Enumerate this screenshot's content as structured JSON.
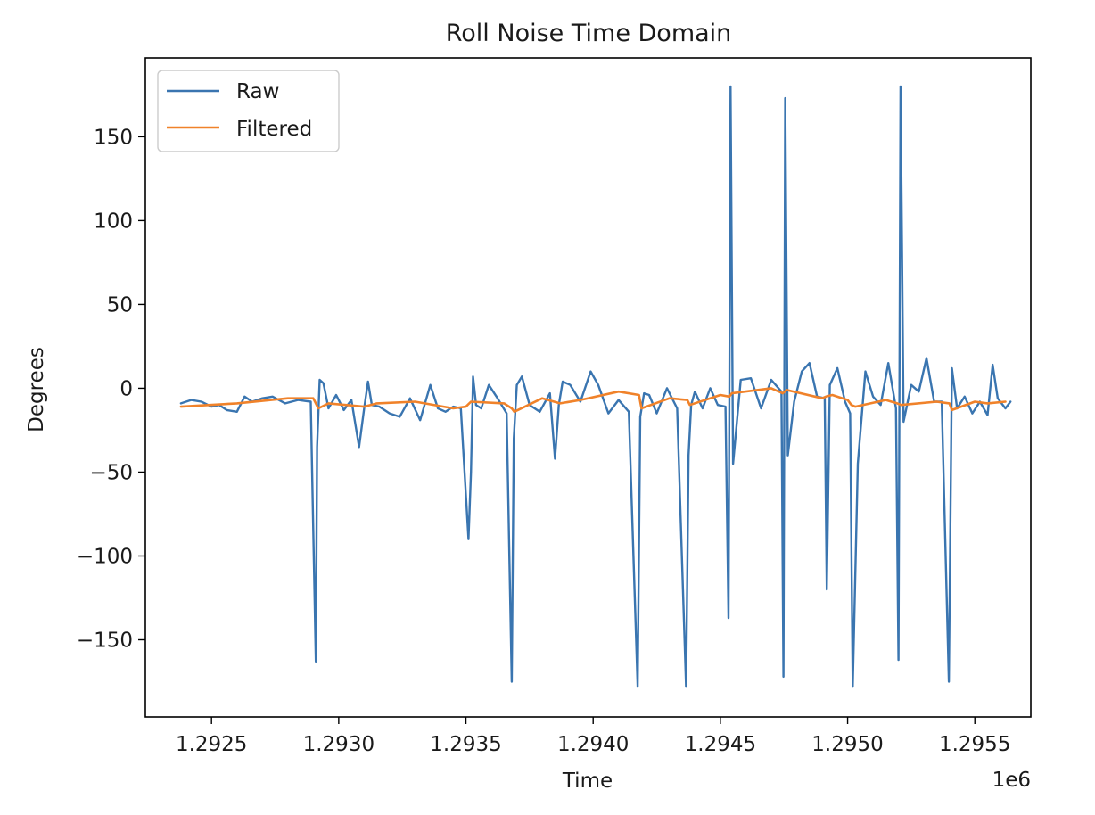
{
  "chart_data": {
    "type": "line",
    "title": "Roll Noise Time Domain",
    "xlabel": "Time",
    "ylabel": "Degrees",
    "x_offset_label": "1e6",
    "xlim": [
      1292240,
      1295720
    ],
    "ylim": [
      -196,
      197
    ],
    "xticks": [
      1292500,
      1293000,
      1293500,
      1294000,
      1294500,
      1295000,
      1295500
    ],
    "xtick_labels": [
      "1.2925",
      "1.2930",
      "1.2935",
      "1.2940",
      "1.2945",
      "1.2950",
      "1.2955"
    ],
    "yticks": [
      -150,
      -100,
      -50,
      0,
      50,
      100,
      150
    ],
    "ytick_labels": [
      "−150",
      "−100",
      "−50",
      "0",
      "50",
      "100",
      "150"
    ],
    "grid": false,
    "legend": {
      "position": "top-left"
    },
    "series": [
      {
        "name": "Raw",
        "color": "#3a75b0",
        "x": [
          1292380,
          1292420,
          1292460,
          1292500,
          1292530,
          1292560,
          1292600,
          1292630,
          1292660,
          1292700,
          1292740,
          1292790,
          1292840,
          1292890,
          1292910,
          1292915,
          1292925,
          1292940,
          1292960,
          1292990,
          1293020,
          1293050,
          1293080,
          1293100,
          1293115,
          1293130,
          1293160,
          1293200,
          1293240,
          1293280,
          1293320,
          1293360,
          1293390,
          1293420,
          1293450,
          1293480,
          1293510,
          1293520,
          1293528,
          1293540,
          1293560,
          1293590,
          1293620,
          1293660,
          1293680,
          1293688,
          1293700,
          1293720,
          1293750,
          1293790,
          1293830,
          1293850,
          1293865,
          1293880,
          1293910,
          1293950,
          1293990,
          1294020,
          1294060,
          1294100,
          1294140,
          1294175,
          1294185,
          1294200,
          1294220,
          1294250,
          1294290,
          1294330,
          1294365,
          1294375,
          1294385,
          1294400,
          1294430,
          1294460,
          1294490,
          1294520,
          1294532,
          1294540,
          1294550,
          1294580,
          1294620,
          1294660,
          1294700,
          1294740,
          1294748,
          1294755,
          1294765,
          1294790,
          1294820,
          1294850,
          1294880,
          1294910,
          1294918,
          1294930,
          1294960,
          1294990,
          1295010,
          1295020,
          1295040,
          1295070,
          1295100,
          1295130,
          1295160,
          1295190,
          1295200,
          1295208,
          1295220,
          1295250,
          1295280,
          1295310,
          1295340,
          1295370,
          1295398,
          1295410,
          1295430,
          1295460,
          1295490,
          1295520,
          1295550,
          1295570,
          1295590,
          1295620,
          1295640
        ],
        "y": [
          -9,
          -7,
          -8,
          -11,
          -10,
          -13,
          -14,
          -5,
          -8,
          -6,
          -5,
          -9,
          -7,
          -8,
          -163,
          -35,
          5,
          3,
          -12,
          -4,
          -13,
          -7,
          -35,
          -12,
          4,
          -10,
          -11,
          -15,
          -17,
          -6,
          -19,
          2,
          -12,
          -14,
          -11,
          -12,
          -90,
          -50,
          7,
          -10,
          -12,
          2,
          -5,
          -15,
          -175,
          -30,
          2,
          7,
          -10,
          -14,
          -3,
          -42,
          -10,
          4,
          2,
          -8,
          10,
          2,
          -15,
          -7,
          -14,
          -178,
          -17,
          -3,
          -4,
          -15,
          0,
          -12,
          -178,
          -40,
          -10,
          -2,
          -12,
          0,
          -10,
          -11,
          -137,
          180,
          -45,
          5,
          6,
          -12,
          5,
          -2,
          -172,
          173,
          -40,
          -8,
          10,
          15,
          -5,
          -6,
          -120,
          2,
          12,
          -8,
          -15,
          -178,
          -45,
          10,
          -5,
          -10,
          15,
          -12,
          -162,
          180,
          -20,
          2,
          -2,
          18,
          -8,
          -8,
          -175,
          12,
          -12,
          -5,
          -15,
          -8,
          -16,
          14,
          -6,
          -12,
          -8
        ]
      },
      {
        "name": "Filtered",
        "color": "#f0822a",
        "x": [
          1292380,
          1292600,
          1292800,
          1292900,
          1292920,
          1292960,
          1293100,
          1293150,
          1293300,
          1293450,
          1293500,
          1293520,
          1293650,
          1293680,
          1293690,
          1293800,
          1293870,
          1293950,
          1294100,
          1294180,
          1294190,
          1294300,
          1294370,
          1294380,
          1294500,
          1294535,
          1294545,
          1294700,
          1294745,
          1294760,
          1294900,
          1294915,
          1294940,
          1295000,
          1295015,
          1295030,
          1295150,
          1295195,
          1295210,
          1295350,
          1295400,
          1295410,
          1295500,
          1295550,
          1295620
        ],
        "y": [
          -11,
          -9,
          -6,
          -6,
          -12,
          -9,
          -11,
          -9,
          -8,
          -12,
          -11,
          -8,
          -9,
          -12,
          -14,
          -6,
          -9,
          -7,
          -2,
          -4,
          -12,
          -6,
          -7,
          -10,
          -4,
          -5,
          -3,
          0,
          -3,
          -1,
          -6,
          -5,
          -4,
          -7,
          -10,
          -11,
          -7,
          -9,
          -10,
          -8,
          -9,
          -13,
          -8,
          -9,
          -8
        ]
      }
    ]
  }
}
